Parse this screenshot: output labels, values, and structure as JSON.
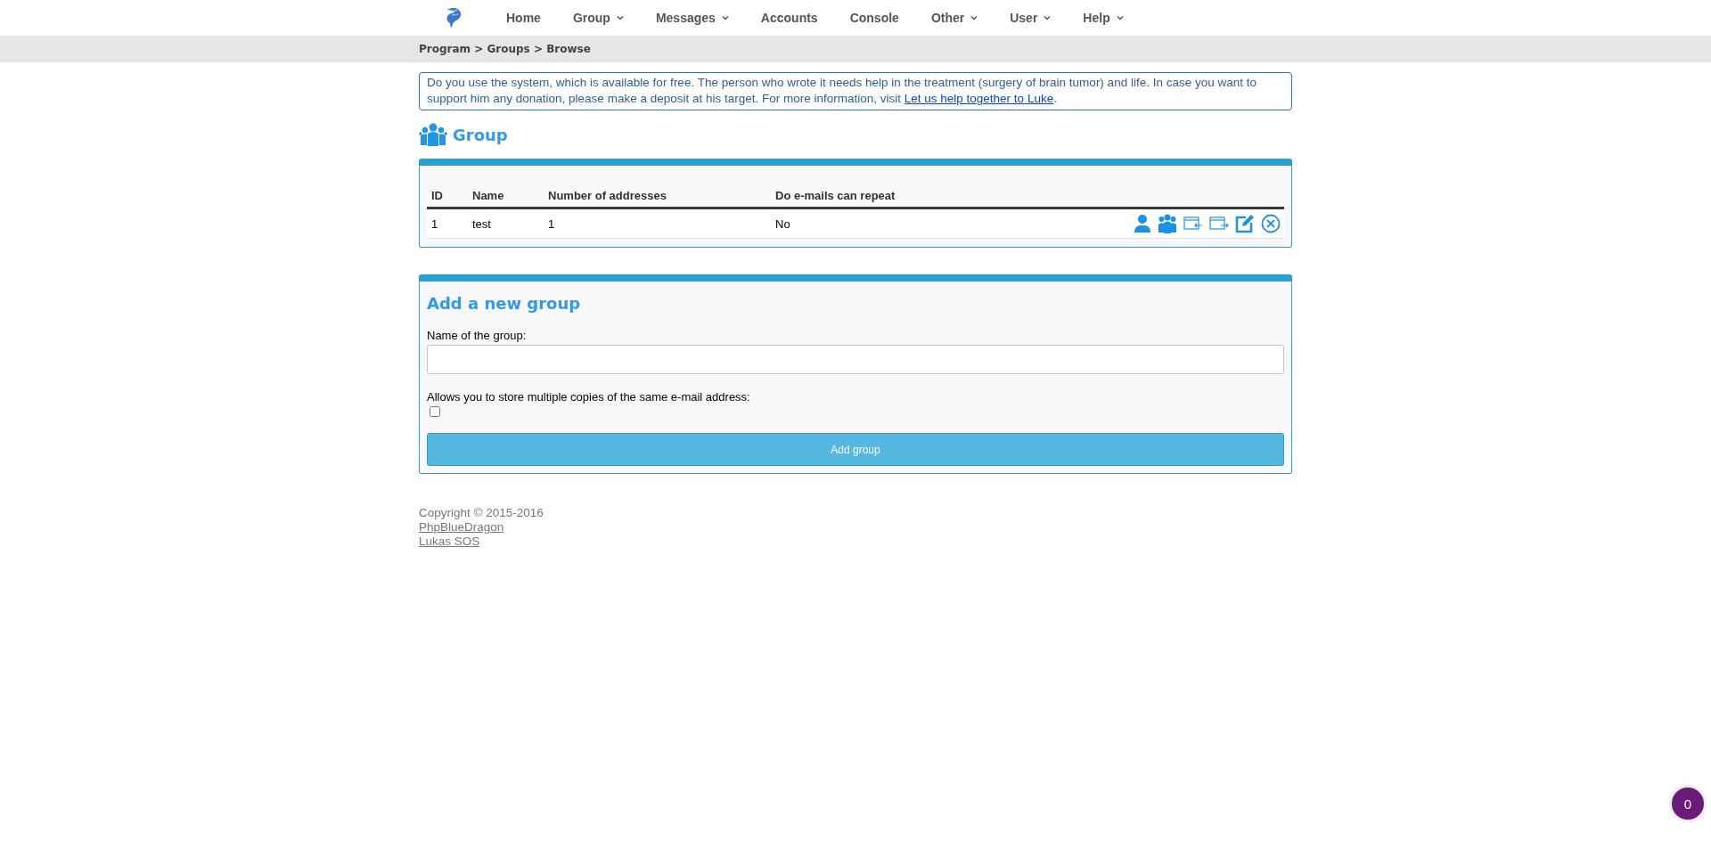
{
  "nav": {
    "items": [
      {
        "label": "Home",
        "dropdown": false
      },
      {
        "label": "Group",
        "dropdown": true
      },
      {
        "label": "Messages",
        "dropdown": true
      },
      {
        "label": "Accounts",
        "dropdown": false
      },
      {
        "label": "Console",
        "dropdown": false
      },
      {
        "label": "Other",
        "dropdown": true
      },
      {
        "label": "User",
        "dropdown": true
      },
      {
        "label": "Help",
        "dropdown": true
      }
    ]
  },
  "breadcrumb": "Program > Groups > Browse",
  "notice": {
    "text": "Do you use the system, which is available for free. The person who wrote it needs help in the treatment (surgery of brain tumor) and life. In case you want to support him any donation, please make a deposit at his target. For more information, visit ",
    "link": "Let us help together to Luke",
    "suffix": "."
  },
  "heading": "Group",
  "table": {
    "columns": [
      "ID",
      "Name",
      "Number of addresses",
      "Do e-mails can repeat"
    ],
    "rows": [
      {
        "cells": [
          "1",
          "test",
          "1",
          "No"
        ]
      }
    ]
  },
  "form": {
    "title": "Add a new group",
    "name_label": "Name of the group:",
    "copies_label": "Allows you to store multiple copies of the same e-mail address:",
    "copies_checked": false,
    "submit": "Add group"
  },
  "footer": {
    "copyright": "Copyright © 2015-2016",
    "links": [
      "PhpBlueDragon",
      "Lukas SOS"
    ]
  },
  "badge": "0"
}
